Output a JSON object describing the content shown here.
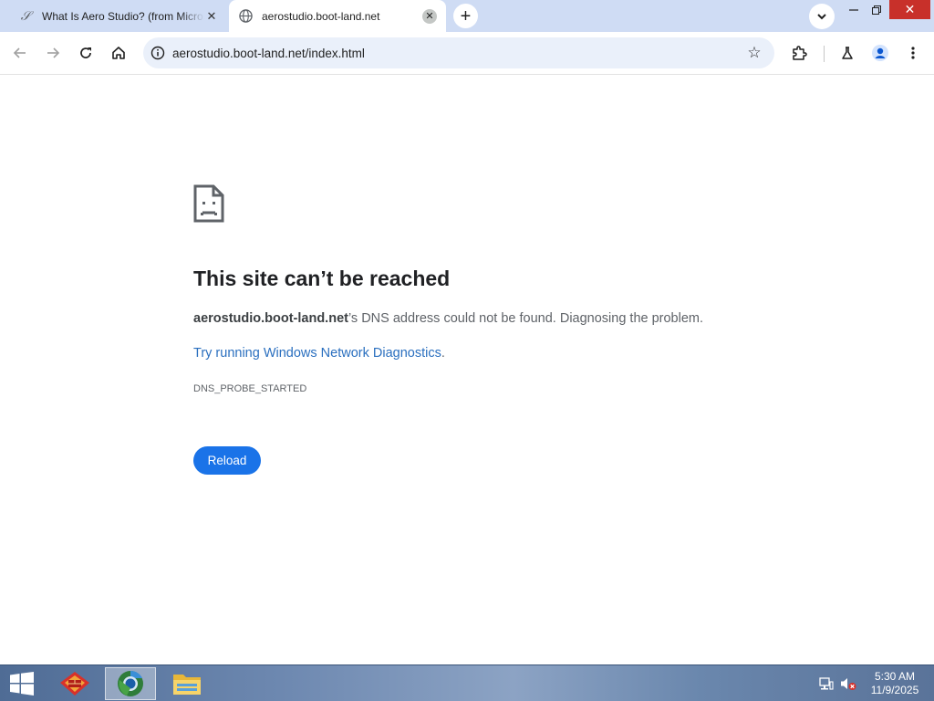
{
  "browser": {
    "tabs": [
      {
        "title": "What Is Aero Studio? (from Microsoft)",
        "favicon": "script-s-icon",
        "active": false
      },
      {
        "title": "aerostudio.boot-land.net",
        "favicon": "globe-icon",
        "active": true
      }
    ],
    "url": "aerostudio.boot-land.net/index.html"
  },
  "error": {
    "title": "This site can’t be reached",
    "host": "aerostudio.boot-land.net",
    "description_rest": "’s DNS address could not be found. Diagnosing the problem.",
    "suggestion_link": "Try running Windows Network Diagnostics",
    "suggestion_end": ".",
    "code": "DNS_PROBE_STARTED",
    "reload_label": "Reload"
  },
  "taskbar": {
    "apps": [
      "firewall-app-icon",
      "browser-app-icon",
      "file-explorer-icon"
    ],
    "time": "5:30 AM",
    "date": "11/9/2025"
  },
  "colors": {
    "accent": "#1a73e8",
    "tabstrip": "#cfdcf4",
    "close": "#c8302a"
  }
}
